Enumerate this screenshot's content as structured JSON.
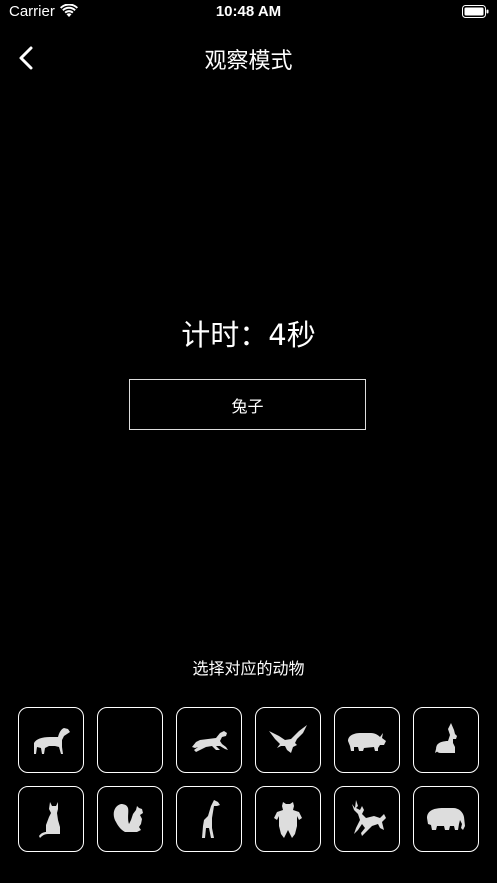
{
  "status_bar": {
    "carrier": "Carrier",
    "time": "10:48 AM"
  },
  "nav": {
    "title": "观察模式",
    "back_icon": "chevron-left-icon"
  },
  "timer_text": "计时：4秒",
  "answer": "兔子",
  "prompt": "选择对应的动物",
  "animals": [
    {
      "icon": "dog-icon"
    },
    {
      "icon": "blank-tile"
    },
    {
      "icon": "horse-icon"
    },
    {
      "icon": "eagle-icon"
    },
    {
      "icon": "rhino-icon"
    },
    {
      "icon": "rabbit-icon"
    },
    {
      "icon": "cat-icon"
    },
    {
      "icon": "squirrel-icon"
    },
    {
      "icon": "giraffe-icon"
    },
    {
      "icon": "bear-icon"
    },
    {
      "icon": "deer-icon"
    },
    {
      "icon": "elephant-icon"
    }
  ],
  "colors": {
    "background": "#000000",
    "text": "#ffffff",
    "icon": "#dddddd"
  }
}
